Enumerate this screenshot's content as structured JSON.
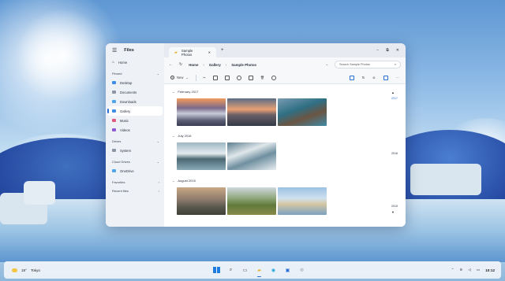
{
  "window": {
    "app_title": "Files",
    "tab_title": "Sample Photos",
    "add_tab": "+",
    "minimize": "−",
    "maximize": "⧉",
    "close": "✕"
  },
  "sidebar": {
    "home": "Home",
    "pinned_header": "Pinned",
    "pinned": [
      {
        "label": "Desktop",
        "icon": "desktop-icon"
      },
      {
        "label": "Documents",
        "icon": "documents-icon"
      },
      {
        "label": "Downloads",
        "icon": "downloads-icon"
      },
      {
        "label": "Gallery",
        "icon": "gallery-icon"
      },
      {
        "label": "Music",
        "icon": "music-icon"
      },
      {
        "label": "Videos",
        "icon": "videos-icon"
      }
    ],
    "drives_header": "Drives",
    "drives": [
      {
        "label": "System",
        "icon": "drive-icon"
      }
    ],
    "cloud_header": "Cloud Drives",
    "cloud": [
      {
        "label": "OneDrive",
        "icon": "cloud-icon"
      }
    ],
    "favorites_header": "Favorites",
    "recent_header": "Recent files"
  },
  "address": {
    "crumbs": [
      "Home",
      "Gallery",
      "Sample Photos"
    ],
    "search_placeholder": "Search Sample Photos"
  },
  "toolbar": {
    "new_label": "New"
  },
  "gallery": {
    "groups": [
      {
        "label": "February 2017",
        "count": 3,
        "marker": "2017"
      },
      {
        "label": "July 2016",
        "count": 2,
        "marker": "2016"
      },
      {
        "label": "August 2015",
        "count": 3,
        "marker": "2015"
      }
    ]
  },
  "taskbar": {
    "temperature": "18°",
    "city": "Tokyo",
    "time": "10:12"
  },
  "colors": {
    "accent": "#2a6fd6",
    "folder": "#e6b43a"
  }
}
